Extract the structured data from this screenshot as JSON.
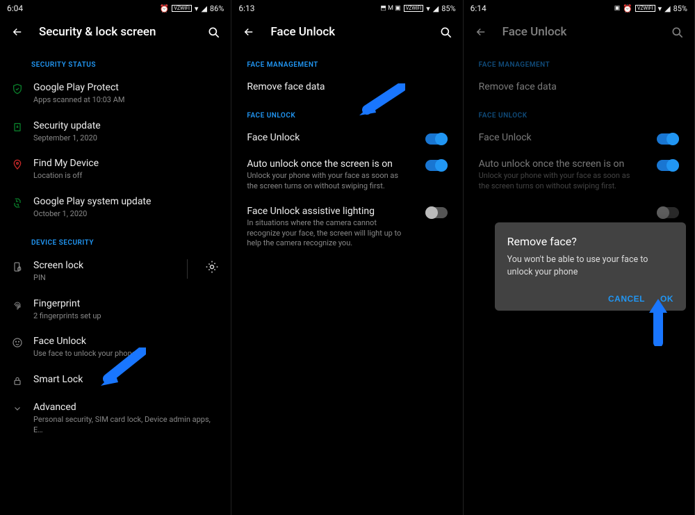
{
  "screen1": {
    "status": {
      "time": "6:04",
      "battery": "86%",
      "wifi_tag": "VZWIFI"
    },
    "title": "Security & lock screen",
    "sections": {
      "security_status": "SECURITY STATUS",
      "device_security": "DEVICE SECURITY"
    },
    "items": {
      "play_protect": {
        "title": "Google Play Protect",
        "sub": "Apps scanned at 10:03 AM"
      },
      "security_update": {
        "title": "Security update",
        "sub": "September 1, 2020"
      },
      "find_my_device": {
        "title": "Find My Device",
        "sub": "Location is off"
      },
      "play_system_update": {
        "title": "Google Play system update",
        "sub": "October 1, 2020"
      },
      "screen_lock": {
        "title": "Screen lock",
        "sub": "PIN"
      },
      "fingerprint": {
        "title": "Fingerprint",
        "sub": "2 fingerprints set up"
      },
      "face_unlock": {
        "title": "Face Unlock",
        "sub": "Use face to unlock your phone"
      },
      "smart_lock": {
        "title": "Smart Lock"
      },
      "advanced": {
        "title": "Advanced",
        "sub": "Personal security, SIM card lock, Device admin apps, E…"
      }
    }
  },
  "screen2": {
    "status": {
      "time": "6:13",
      "battery": "85%",
      "wifi_tag": "VZWIFI"
    },
    "title": "Face Unlock",
    "sections": {
      "face_management": "FACE MANAGEMENT",
      "face_unlock": "FACE UNLOCK"
    },
    "items": {
      "remove_face": {
        "title": "Remove face data"
      },
      "face_unlock_toggle": {
        "title": "Face Unlock"
      },
      "auto_unlock": {
        "title": "Auto unlock once the screen is on",
        "sub": "Unlock your phone with your face as soon as the screen turns on without swiping first."
      },
      "assistive": {
        "title": "Face Unlock assistive lighting",
        "sub": "In situations where the camera cannot recognize your face, the screen will light up to help the camera recognize you."
      }
    }
  },
  "screen3": {
    "status": {
      "time": "6:14",
      "battery": "85%",
      "wifi_tag": "VZWIFI"
    },
    "title": "Face Unlock",
    "sections": {
      "face_management": "FACE MANAGEMENT",
      "face_unlock": "FACE UNLOCK"
    },
    "items": {
      "remove_face": {
        "title": "Remove face data"
      },
      "face_unlock_toggle": {
        "title": "Face Unlock"
      },
      "auto_unlock": {
        "title": "Auto unlock once the screen is on",
        "sub": "Unlock your phone with your face as soon as the screen turns on without swiping first."
      }
    },
    "dialog": {
      "title": "Remove face?",
      "body": "You won't be able to use your face to unlock your phone",
      "cancel": "CANCEL",
      "ok": "OK"
    }
  }
}
